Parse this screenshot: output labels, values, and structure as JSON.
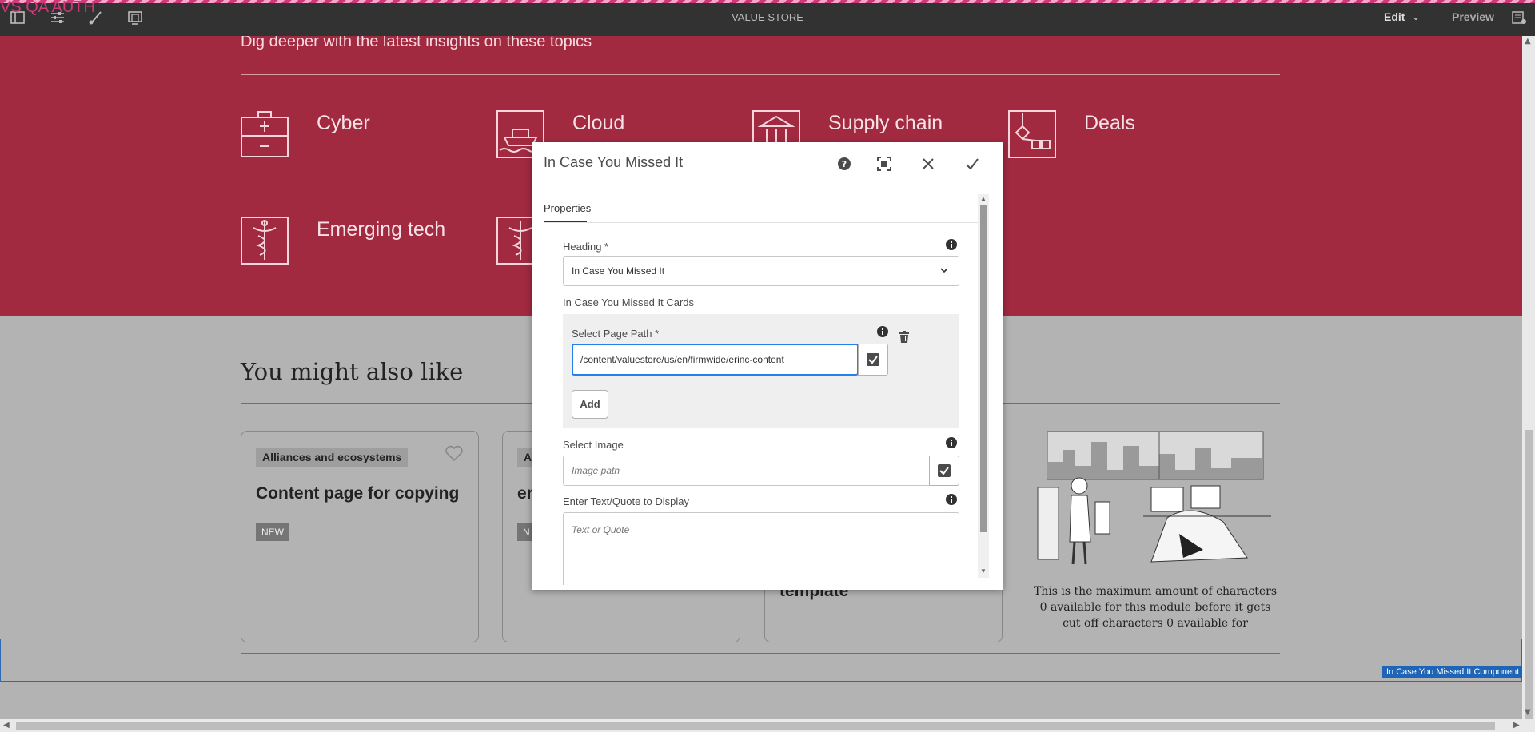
{
  "topbar": {
    "env_label": "VS QA AUTH",
    "title": "VALUE STORE",
    "edit_label": "Edit",
    "preview_label": "Preview",
    "icons": [
      "side-panel-icon",
      "properties-icon",
      "paintbrush-icon",
      "emulator-icon",
      "annotations-icon"
    ]
  },
  "hero": {
    "subtitle": "Dig deeper with the latest insights on these topics",
    "topics": [
      {
        "label": "Cyber",
        "icon": "first-aid-kit-icon"
      },
      {
        "label": "Cloud",
        "icon": "ship-icon"
      },
      {
        "label": "Supply chain",
        "icon": "bank-icon"
      },
      {
        "label": "Deals",
        "icon": "network-icon"
      },
      {
        "label": "Emerging tech",
        "icon": "caduceus-icon"
      },
      {
        "label": "",
        "icon": "caduceus-icon"
      }
    ]
  },
  "related": {
    "heading": "You might also like",
    "cards": [
      {
        "tag": "Alliances and ecosystems",
        "title": "Content page for copying",
        "badge": "NEW"
      },
      {
        "tag": "A",
        "title": "er",
        "badge": "N"
      },
      {
        "title": "template"
      }
    ],
    "quote": "This is the maximum amount of characters 0 available for this module before it gets cut off characters 0 available for"
  },
  "component_label": "In Case You Missed It Component",
  "dialog": {
    "title": "In Case You Missed It",
    "tab": "Properties",
    "heading_label": "Heading *",
    "heading_value": "In Case You Missed It",
    "cards_label": "In Case You Missed It Cards",
    "page_path_label": "Select Page Path *",
    "page_path_value": "/content/valuestore/us/en/firmwide/erinc-content",
    "add_label": "Add",
    "image_label": "Select Image",
    "image_placeholder": "Image path",
    "text_label": "Enter Text/Quote to Display",
    "text_placeholder": "Text or Quote"
  },
  "colors": {
    "hero_bg": "#a22a40",
    "toolbar_bg": "#323232",
    "accent_blue": "#2680eb",
    "env_pink": "#d0387a"
  }
}
